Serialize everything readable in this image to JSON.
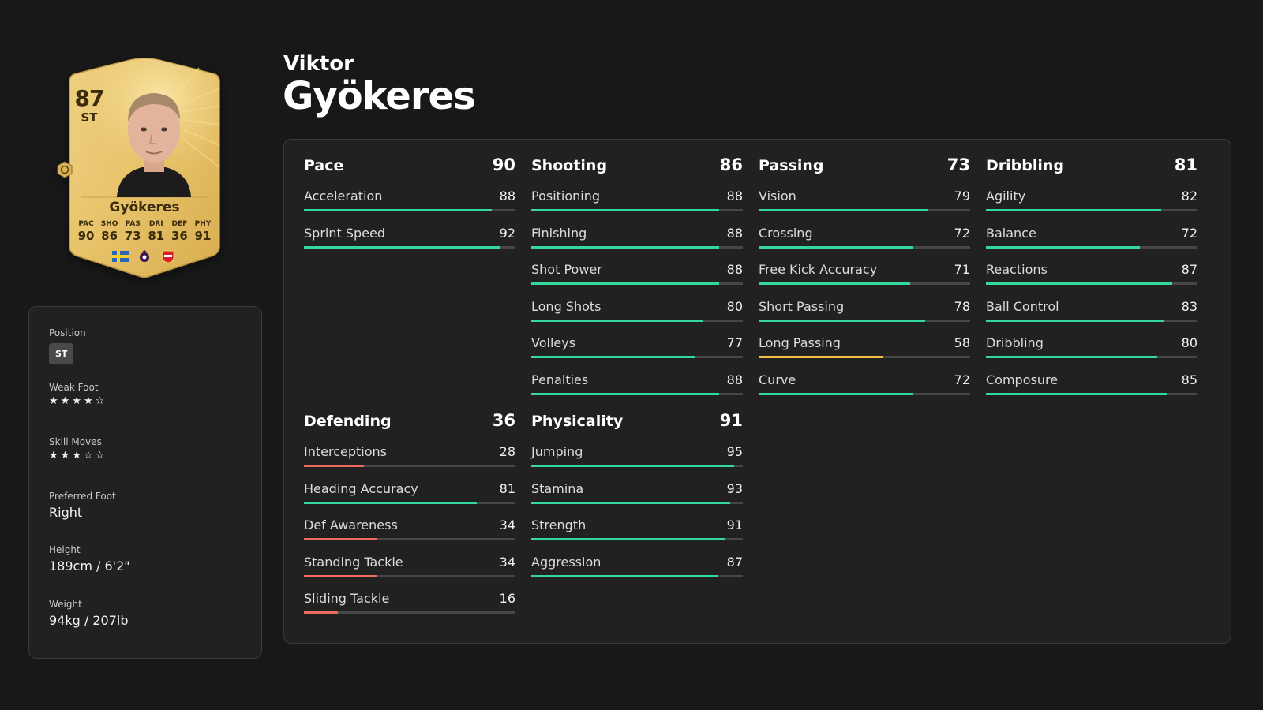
{
  "player": {
    "first_name": "Viktor",
    "last_name": "Gyökeres"
  },
  "card": {
    "rating": "87",
    "position": "ST",
    "name": "Gyökeres",
    "stats": [
      {
        "label": "PAC",
        "value": "90"
      },
      {
        "label": "SHO",
        "value": "86"
      },
      {
        "label": "PAS",
        "value": "73"
      },
      {
        "label": "DRI",
        "value": "81"
      },
      {
        "label": "DEF",
        "value": "36"
      },
      {
        "label": "PHY",
        "value": "91"
      }
    ],
    "icons": [
      "sweden-flag-icon",
      "league-icon",
      "club-crest-icon"
    ]
  },
  "info": {
    "position_label": "Position",
    "position_value": "ST",
    "weak_foot_label": "Weak Foot",
    "weak_foot_stars": 4,
    "skill_moves_label": "Skill Moves",
    "skill_moves_stars": 3,
    "preferred_foot_label": "Preferred Foot",
    "preferred_foot_value": "Right",
    "height_label": "Height",
    "height_value": "189cm / 6'2\"",
    "weight_label": "Weight",
    "weight_value": "94kg / 207lb"
  },
  "colors": {
    "bar_high": "#34d89a",
    "bar_mid": "#f0c048",
    "bar_low": "#ef6a60",
    "bar_track": "#474747"
  },
  "stats": [
    {
      "name": "Pace",
      "total": "90",
      "attrs": [
        {
          "name": "Acceleration",
          "value": 88
        },
        {
          "name": "Sprint Speed",
          "value": 92
        }
      ]
    },
    {
      "name": "Shooting",
      "total": "86",
      "attrs": [
        {
          "name": "Positioning",
          "value": 88
        },
        {
          "name": "Finishing",
          "value": 88
        },
        {
          "name": "Shot Power",
          "value": 88
        },
        {
          "name": "Long Shots",
          "value": 80
        },
        {
          "name": "Volleys",
          "value": 77
        },
        {
          "name": "Penalties",
          "value": 88
        }
      ]
    },
    {
      "name": "Passing",
      "total": "73",
      "attrs": [
        {
          "name": "Vision",
          "value": 79
        },
        {
          "name": "Crossing",
          "value": 72
        },
        {
          "name": "Free Kick Accuracy",
          "value": 71
        },
        {
          "name": "Short Passing",
          "value": 78
        },
        {
          "name": "Long Passing",
          "value": 58
        },
        {
          "name": "Curve",
          "value": 72
        }
      ]
    },
    {
      "name": "Dribbling",
      "total": "81",
      "attrs": [
        {
          "name": "Agility",
          "value": 82
        },
        {
          "name": "Balance",
          "value": 72
        },
        {
          "name": "Reactions",
          "value": 87
        },
        {
          "name": "Ball Control",
          "value": 83
        },
        {
          "name": "Dribbling",
          "value": 80
        },
        {
          "name": "Composure",
          "value": 85
        }
      ]
    },
    {
      "name": "Defending",
      "total": "36",
      "attrs": [
        {
          "name": "Interceptions",
          "value": 28
        },
        {
          "name": "Heading Accuracy",
          "value": 81
        },
        {
          "name": "Def Awareness",
          "value": 34
        },
        {
          "name": "Standing Tackle",
          "value": 34
        },
        {
          "name": "Sliding Tackle",
          "value": 16
        }
      ]
    },
    {
      "name": "Physicality",
      "total": "91",
      "attrs": [
        {
          "name": "Jumping",
          "value": 95
        },
        {
          "name": "Stamina",
          "value": 93
        },
        {
          "name": "Strength",
          "value": 91
        },
        {
          "name": "Aggression",
          "value": 87
        }
      ]
    }
  ]
}
